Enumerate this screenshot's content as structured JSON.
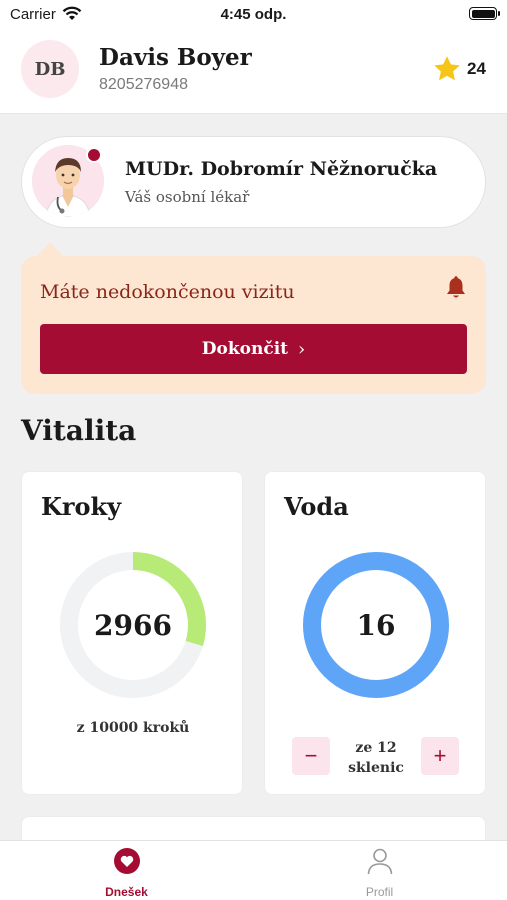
{
  "status_bar": {
    "carrier": "Carrier",
    "time": "4:45 odp.",
    "icons": [
      "wifi-icon",
      "battery-icon"
    ]
  },
  "user": {
    "initials": "DB",
    "name": "Davis Boyer",
    "id": "8205276948",
    "points": "24",
    "points_icon": "star-icon"
  },
  "doctor": {
    "name": "MUDr. Dobromír Něžnoručka",
    "role": "Váš osobní lékař",
    "has_notification": true
  },
  "visit_alert": {
    "text": "Máte nedokončenou vizitu",
    "button_label": "Dokončit",
    "icon": "bell-icon"
  },
  "vitals": {
    "title": "Vitalita",
    "steps": {
      "title": "Kroky",
      "value": "2966",
      "goal_text": "z 10000 kroků",
      "progress": 0.2966
    },
    "water": {
      "title": "Voda",
      "value": "16",
      "goal_text": "ze 12 sklenic",
      "progress": 1.0
    }
  },
  "tabs": [
    {
      "label": "Dnešek",
      "icon": "heart-icon",
      "active": true
    },
    {
      "label": "Profil",
      "icon": "person-icon",
      "active": false
    }
  ],
  "colors": {
    "accent": "#a50c34",
    "alert_bg": "#fde7d3",
    "steps_ring": "#b8ea78",
    "water_ring": "#5ea5f8",
    "ring_track": "#f1f2f4",
    "star": "#f5c518"
  }
}
